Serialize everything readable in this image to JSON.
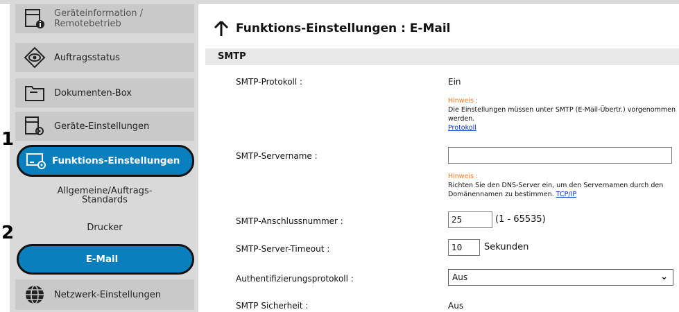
{
  "sidebar": {
    "items": [
      {
        "label": "Geräteinformation / Remotebetrieb",
        "icon": "device-info-icon"
      },
      {
        "label": "Auftragsstatus",
        "icon": "eye-icon"
      },
      {
        "label": "Dokumenten-Box",
        "icon": "folder-icon"
      },
      {
        "label": "Geräte-Einstellungen",
        "icon": "device-settings-icon"
      },
      {
        "label": "Funktions-Einstellungen",
        "icon": "function-settings-icon"
      },
      {
        "label": "Allgemeine/Auftrags-Standards"
      },
      {
        "label": "Drucker"
      },
      {
        "label": "E-Mail"
      },
      {
        "label": "Netzwerk-Einstellungen",
        "icon": "globe-icon"
      }
    ],
    "callouts": [
      "1",
      "2"
    ],
    "accent_color": "#0a7fbd"
  },
  "main": {
    "title": "Funktions-Einstellungen : E-Mail",
    "section": "SMTP",
    "fields": {
      "protocol": {
        "label": "SMTP-Protokoll :",
        "value": "Ein"
      },
      "note1": {
        "hint": "Hinweis :",
        "text": "Die Einstellungen müssen unter SMTP (E-Mail-Übertr.) vorgenommen werden.",
        "link": "Protokoll"
      },
      "servername": {
        "label": "SMTP-Servername :",
        "value": ""
      },
      "note2": {
        "hint": "Hinweis :",
        "text": "Richten Sie den DNS-Server ein, um den Servernamen durch den Domänennamen zu bestimmen.",
        "link": "TCP/IP"
      },
      "port": {
        "label": "SMTP-Anschlussnummer :",
        "value": "25",
        "range": "(1 - 65535)"
      },
      "timeout": {
        "label": "SMTP-Server-Timeout :",
        "value": "10",
        "unit": "Sekunden"
      },
      "auth": {
        "label": "Authentifizierungsprotokoll :",
        "value": "Aus"
      },
      "security": {
        "label": "SMTP Sicherheit :",
        "value": "Aus"
      }
    }
  }
}
